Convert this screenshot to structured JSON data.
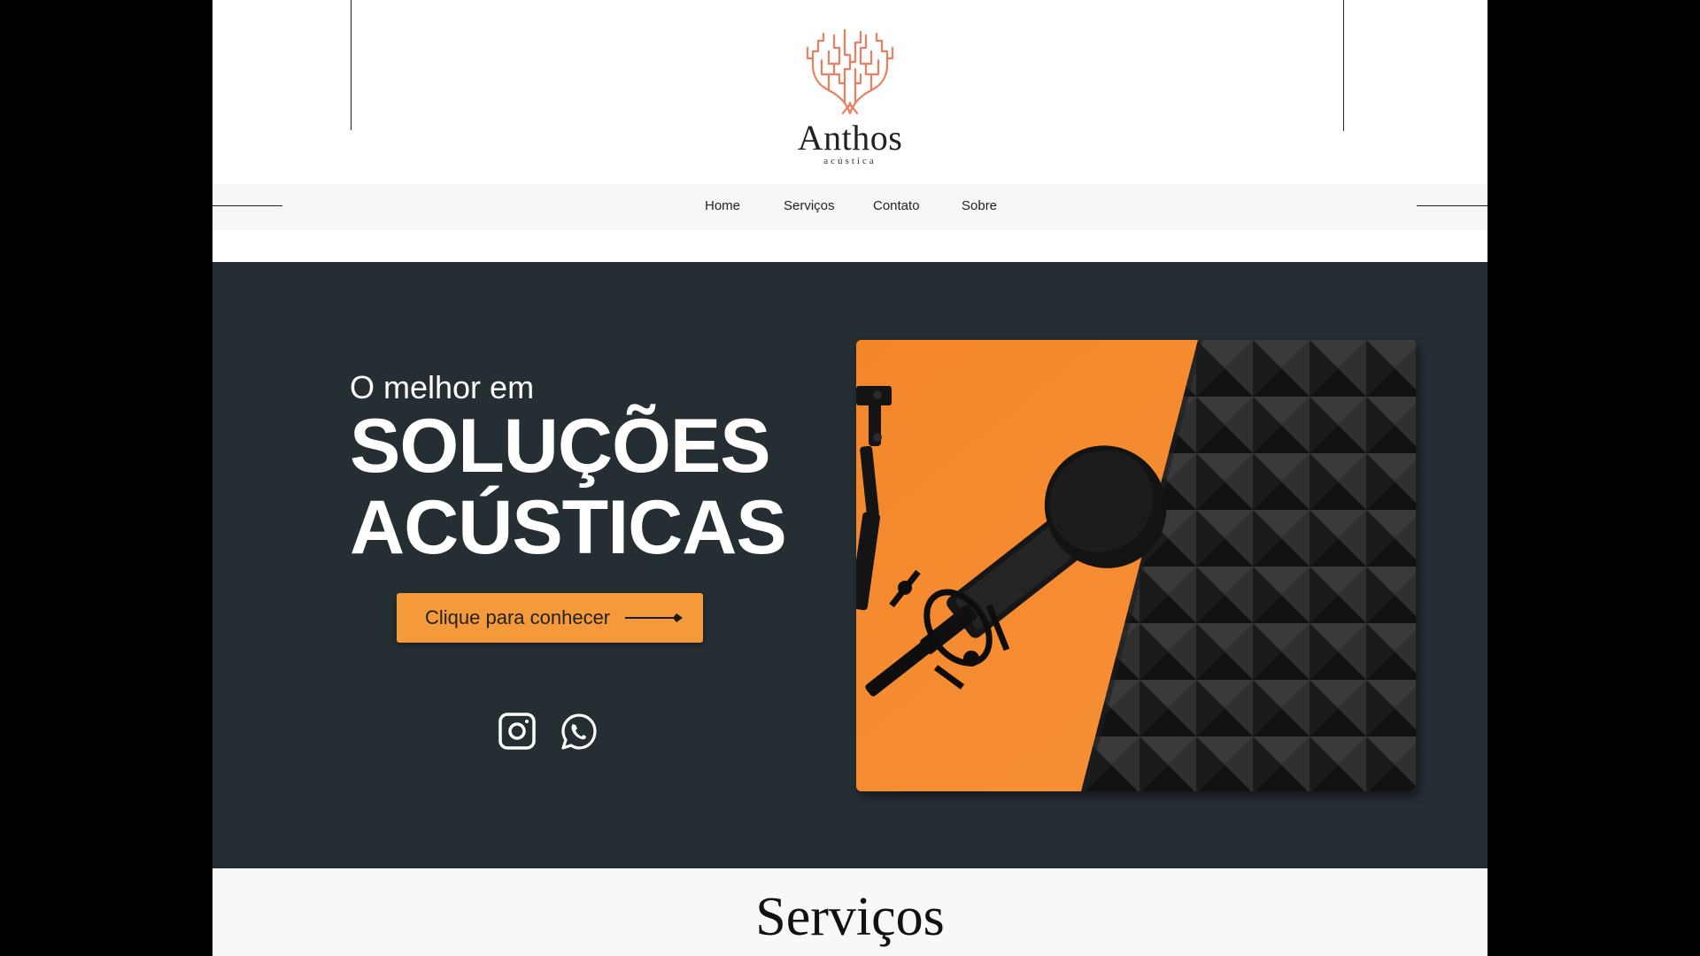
{
  "header": {
    "brand_name": "Anthos",
    "brand_sub": "acústica",
    "logo_icon": "coral-tree-icon",
    "logo_color": "#ef7c5f"
  },
  "nav": {
    "items": [
      {
        "label": "Home"
      },
      {
        "label": "Serviços"
      },
      {
        "label": "Contato"
      },
      {
        "label": "Sobre"
      }
    ]
  },
  "hero": {
    "pre_title": "O melhor em",
    "title_line1": "SOLUÇÕES",
    "title_line2": "ACÚSTICAS",
    "cta_label": "Clique para conhecer",
    "cta_icon": "arrow-right-icon",
    "social": [
      {
        "icon": "instagram-icon"
      },
      {
        "icon": "whatsapp-icon"
      }
    ],
    "image_subject": "microphone-on-orange-with-acoustic-foam"
  },
  "services": {
    "title": "Serviços"
  },
  "colors": {
    "background_outer": "#000000",
    "hero_bg": "#242e33",
    "accent": "#f59a3a",
    "nav_bg": "#f7f7f7",
    "text_dark": "#222222"
  }
}
